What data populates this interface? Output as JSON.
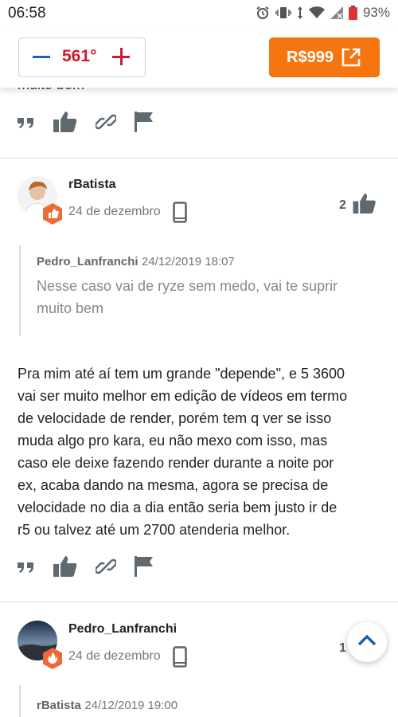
{
  "status_bar": {
    "time": "06:58",
    "battery": "93%"
  },
  "header": {
    "vote_count": "561°",
    "price": "R$999"
  },
  "partial_comment": {
    "text_fragment": "muito bem"
  },
  "comments": [
    {
      "username": "rBatista",
      "date": "24 de dezembro",
      "likes": "2",
      "quote": {
        "author": "Pedro_Lanfranchi",
        "date": "24/12/2019 18:07",
        "text_lines": [
          "Nesse caso vai de ryze sem medo, vai te suprir",
          "muito bem"
        ]
      },
      "body_lines": [
        "Pra mim até aí tem um grande \"depende\", e 5 3600",
        "vai ser muito melhor em edição de vídeos em termo",
        "de velocidade de render, porém tem q ver se isso",
        "muda algo pro kara, eu não mexo com isso, mas",
        "caso ele deixe fazendo render durante a noite por",
        "ex, acaba dando na mesma, agora se precisa de",
        "velocidade no dia a dia então seria bem justo ir de",
        "r5 ou talvez até um 2700 atenderia melhor."
      ]
    },
    {
      "username": "Pedro_Lanfranchi",
      "date": "24 de dezembro",
      "likes": "1",
      "quote_preview": {
        "author": "rBatista",
        "date": "24/12/2019 19:00"
      }
    }
  ],
  "icons": [
    "quote-icon",
    "thumbs-up-icon",
    "link-icon",
    "flag-icon",
    "external-link-icon",
    "device-icon",
    "chevron-up-icon"
  ],
  "colors": {
    "accent": "#f7750f",
    "vote_red": "#cc1b2e",
    "vote_blue": "#1f5fae",
    "badge": "#ef6a3a"
  }
}
